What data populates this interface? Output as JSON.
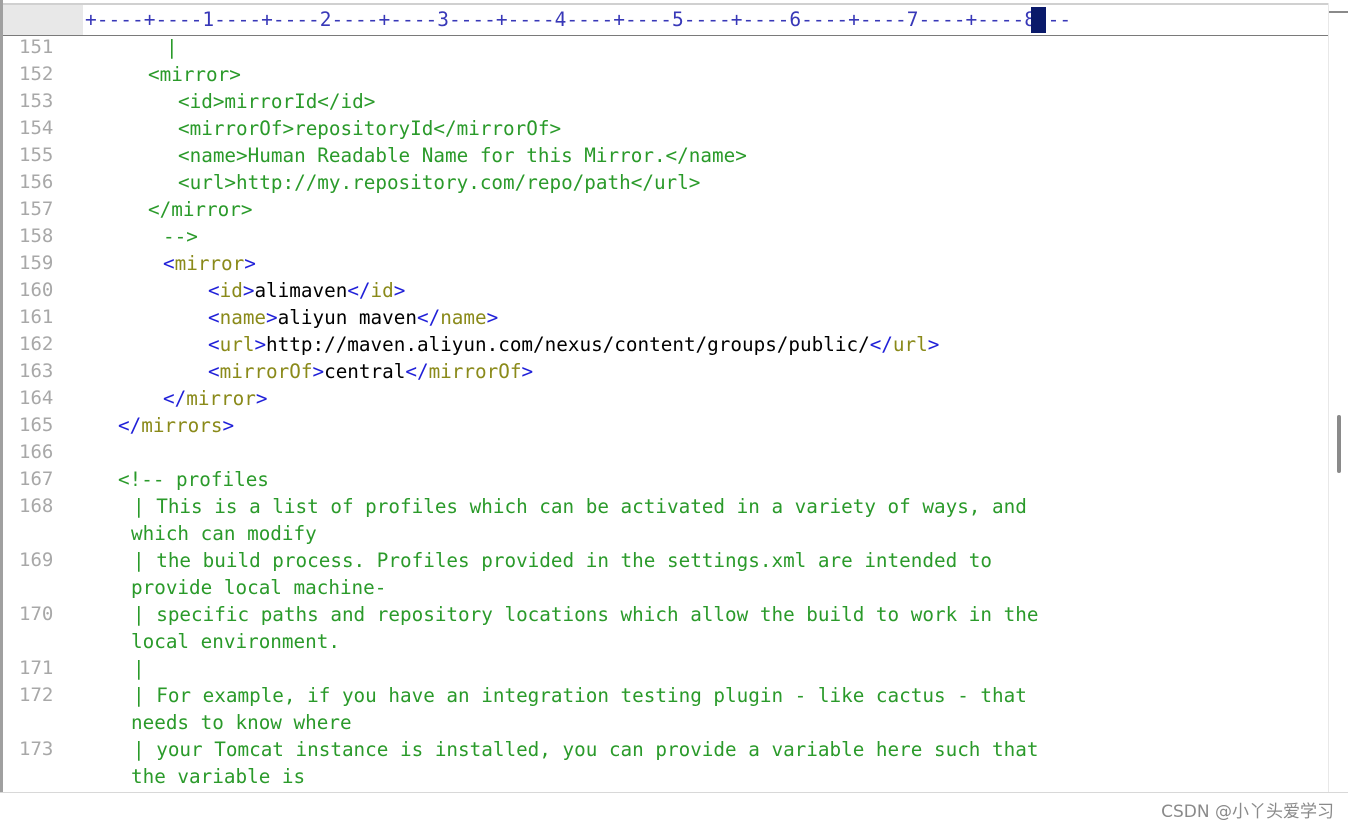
{
  "ruler": {
    "text": "+----+----1----+----2----+----3----+----4----+----5----+----6----+----7----+----8---"
  },
  "lines": [
    {
      "num": "151",
      "segs": [
        {
          "t": "|",
          "c": "cmt"
        }
      ]
    },
    {
      "num": "152",
      "segs": [
        {
          "t": "<mirror>",
          "c": "cmt"
        }
      ]
    },
    {
      "num": "153",
      "segs": [
        {
          "t": "<id>mirrorId</id>",
          "c": "cmt"
        }
      ]
    },
    {
      "num": "154",
      "segs": [
        {
          "t": "<mirrorOf>repositoryId</mirrorOf>",
          "c": "cmt"
        }
      ]
    },
    {
      "num": "155",
      "segs": [
        {
          "t": "<name>Human Readable Name for this Mirror.</name>",
          "c": "cmt"
        }
      ]
    },
    {
      "num": "156",
      "segs": [
        {
          "t": "<url>http://my.repository.com/repo/path</url>",
          "c": "cmt"
        }
      ]
    },
    {
      "num": "157",
      "segs": [
        {
          "t": "</mirror>",
          "c": "cmt"
        }
      ]
    },
    {
      "num": "158",
      "segs": [
        {
          "t": "-->",
          "c": "cmt"
        }
      ]
    },
    {
      "num": "159",
      "segs": [
        {
          "t": "<",
          "c": "tag"
        },
        {
          "t": "mirror",
          "c": "name"
        },
        {
          "t": ">",
          "c": "tag"
        }
      ]
    },
    {
      "num": "160",
      "segs": [
        {
          "t": "<",
          "c": "tag"
        },
        {
          "t": "id",
          "c": "name"
        },
        {
          "t": ">",
          "c": "tag"
        },
        {
          "t": "alimaven",
          "c": "text"
        },
        {
          "t": "</",
          "c": "tag"
        },
        {
          "t": "id",
          "c": "name"
        },
        {
          "t": ">",
          "c": "tag"
        }
      ]
    },
    {
      "num": "161",
      "segs": [
        {
          "t": "<",
          "c": "tag"
        },
        {
          "t": "name",
          "c": "name"
        },
        {
          "t": ">",
          "c": "tag"
        },
        {
          "t": "aliyun maven",
          "c": "text"
        },
        {
          "t": "</",
          "c": "tag"
        },
        {
          "t": "name",
          "c": "name"
        },
        {
          "t": ">",
          "c": "tag"
        }
      ]
    },
    {
      "num": "162",
      "segs": [
        {
          "t": "<",
          "c": "tag"
        },
        {
          "t": "url",
          "c": "name"
        },
        {
          "t": ">",
          "c": "tag"
        },
        {
          "t": "http://maven.aliyun.com/nexus/content/groups/public/",
          "c": "text"
        },
        {
          "t": "</",
          "c": "tag"
        },
        {
          "t": "url",
          "c": "name"
        },
        {
          "t": ">",
          "c": "tag"
        }
      ]
    },
    {
      "num": "163",
      "segs": [
        {
          "t": "<",
          "c": "tag"
        },
        {
          "t": "mirrorOf",
          "c": "name"
        },
        {
          "t": ">",
          "c": "tag"
        },
        {
          "t": "central",
          "c": "text"
        },
        {
          "t": "</",
          "c": "tag"
        },
        {
          "t": "mirrorOf",
          "c": "name"
        },
        {
          "t": ">",
          "c": "tag"
        }
      ]
    },
    {
      "num": "164",
      "segs": [
        {
          "t": "</",
          "c": "tag"
        },
        {
          "t": "mirror",
          "c": "name"
        },
        {
          "t": ">",
          "c": "tag"
        }
      ]
    },
    {
      "num": "165",
      "segs": [
        {
          "t": "</",
          "c": "tag"
        },
        {
          "t": "mirrors",
          "c": "name"
        },
        {
          "t": ">",
          "c": "tag"
        }
      ]
    },
    {
      "num": "166",
      "segs": []
    },
    {
      "num": "167",
      "segs": [
        {
          "t": "<!-- profiles",
          "c": "cmt"
        }
      ]
    },
    {
      "num": "168",
      "segs": [
        {
          "t": "| This is a list of profiles which can be activated in a variety of ways, and",
          "c": "cmt"
        }
      ]
    },
    {
      "num": "",
      "segs": [
        {
          "t": "which can modify",
          "c": "cmt"
        }
      ]
    },
    {
      "num": "169",
      "segs": [
        {
          "t": "| the build process. Profiles provided in the settings.xml are intended to",
          "c": "cmt"
        }
      ]
    },
    {
      "num": "",
      "segs": [
        {
          "t": "provide local machine-",
          "c": "cmt"
        }
      ]
    },
    {
      "num": "170",
      "segs": [
        {
          "t": "| specific paths and repository locations which allow the build to work in the",
          "c": "cmt"
        }
      ]
    },
    {
      "num": "",
      "segs": [
        {
          "t": "local environment.",
          "c": "cmt"
        }
      ]
    },
    {
      "num": "171",
      "segs": [
        {
          "t": "|",
          "c": "cmt"
        }
      ]
    },
    {
      "num": "172",
      "segs": [
        {
          "t": "| For example, if you have an integration testing plugin - like cactus - that",
          "c": "cmt"
        }
      ]
    },
    {
      "num": "",
      "segs": [
        {
          "t": "needs to know where",
          "c": "cmt"
        }
      ]
    },
    {
      "num": "173",
      "segs": [
        {
          "t": "| your Tomcat instance is installed, you can provide a variable here such that",
          "c": "cmt"
        }
      ]
    },
    {
      "num": "",
      "segs": [
        {
          "t": "the variable is",
          "c": "cmt"
        }
      ]
    }
  ],
  "watermark": "CSDN @小丫头爱学习"
}
